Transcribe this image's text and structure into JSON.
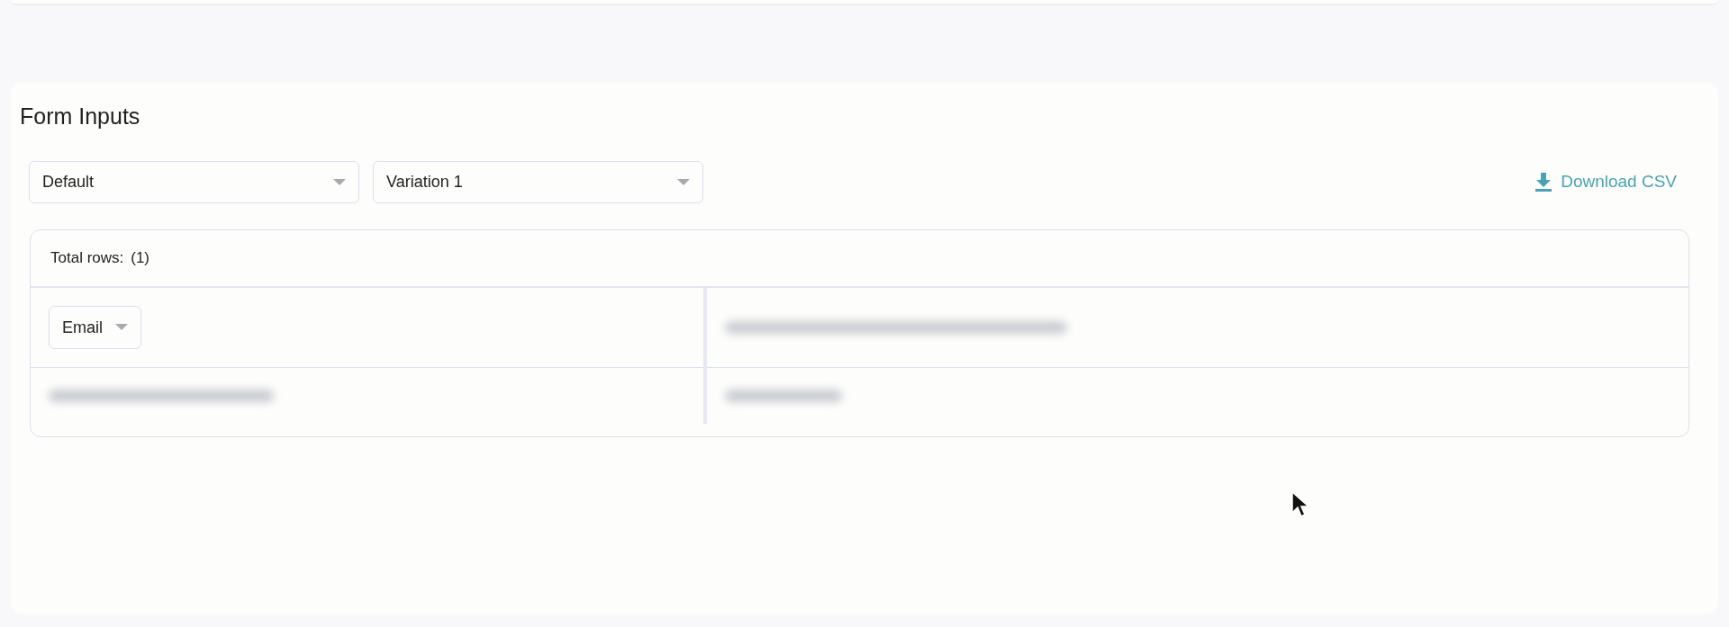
{
  "section": {
    "title": "Form Inputs"
  },
  "filters": [
    {
      "value": "Default"
    },
    {
      "value": "Variation 1"
    }
  ],
  "download": {
    "label": "Download CSV"
  },
  "table": {
    "total_label": "Total rows:",
    "total_count": "(1)",
    "column_selects": [
      {
        "value": "Email"
      }
    ]
  }
}
